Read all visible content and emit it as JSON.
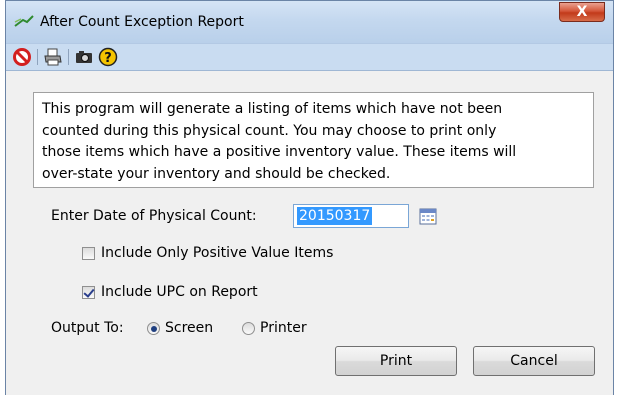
{
  "window": {
    "title": "After Count Exception Report",
    "close_glyph": "X"
  },
  "toolbar": {
    "icons": [
      "cancel-icon",
      "print-icon",
      "camera-icon",
      "help-icon"
    ]
  },
  "description": "This program will generate a listing of items which have not been\ncounted during this physical count. You may choose to print only\nthose items which have a positive inventory value. These items will\nover-state your inventory and should be checked.",
  "date": {
    "label": "Enter Date of Physical Count:",
    "value": "20150317"
  },
  "options": {
    "positive_only": {
      "label": "Include Only Positive Value Items",
      "checked": false
    },
    "include_upc": {
      "label": "Include UPC on Report",
      "checked": true
    }
  },
  "output": {
    "label": "Output To:",
    "screen": "Screen",
    "printer": "Printer",
    "selected": "Screen"
  },
  "buttons": {
    "print": "Print",
    "cancel": "Cancel"
  },
  "colors": {
    "titlebar": "#c4d8ef",
    "toolbar": "#c9dcf1",
    "selection": "#3399ff",
    "close": "#c23a1a"
  }
}
